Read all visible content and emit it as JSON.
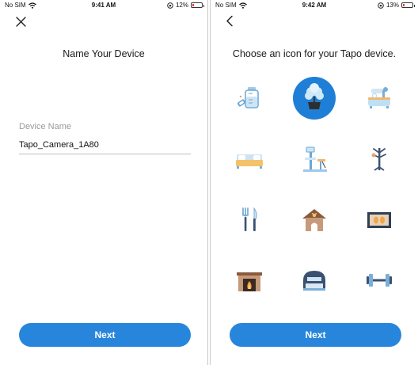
{
  "left_screen": {
    "status": {
      "carrier": "No SIM",
      "time": "9:41 AM",
      "battery": "12%",
      "battery_level": 0.12
    },
    "title": "Name Your Device",
    "field": {
      "label": "Device Name",
      "value": "Tapo_Camera_1A80"
    },
    "next_label": "Next",
    "close_icon": "close-icon"
  },
  "right_screen": {
    "status": {
      "carrier": "No SIM",
      "time": "9:42 AM",
      "battery": "13%",
      "battery_level": 0.13
    },
    "title": "Choose an icon for your Tapo device.",
    "next_label": "Next",
    "back_icon": "back-chevron-icon",
    "icons": [
      {
        "name": "baby-bottle-icon",
        "selected": false
      },
      {
        "name": "plant-pot-icon",
        "selected": true
      },
      {
        "name": "bathtub-icon",
        "selected": false
      },
      {
        "name": "bed-icon",
        "selected": false
      },
      {
        "name": "cat-tree-icon",
        "selected": false
      },
      {
        "name": "coat-rack-icon",
        "selected": false
      },
      {
        "name": "fork-knife-icon",
        "selected": false
      },
      {
        "name": "dog-house-icon",
        "selected": false
      },
      {
        "name": "footprints-frame-icon",
        "selected": false
      },
      {
        "name": "fireplace-icon",
        "selected": false
      },
      {
        "name": "printer-icon",
        "selected": false
      },
      {
        "name": "dumbbell-icon",
        "selected": false
      }
    ]
  },
  "colors": {
    "accent": "#2786db",
    "selected_icon_bg": "#1f7fd6",
    "battery_low": "#e23b3b"
  }
}
